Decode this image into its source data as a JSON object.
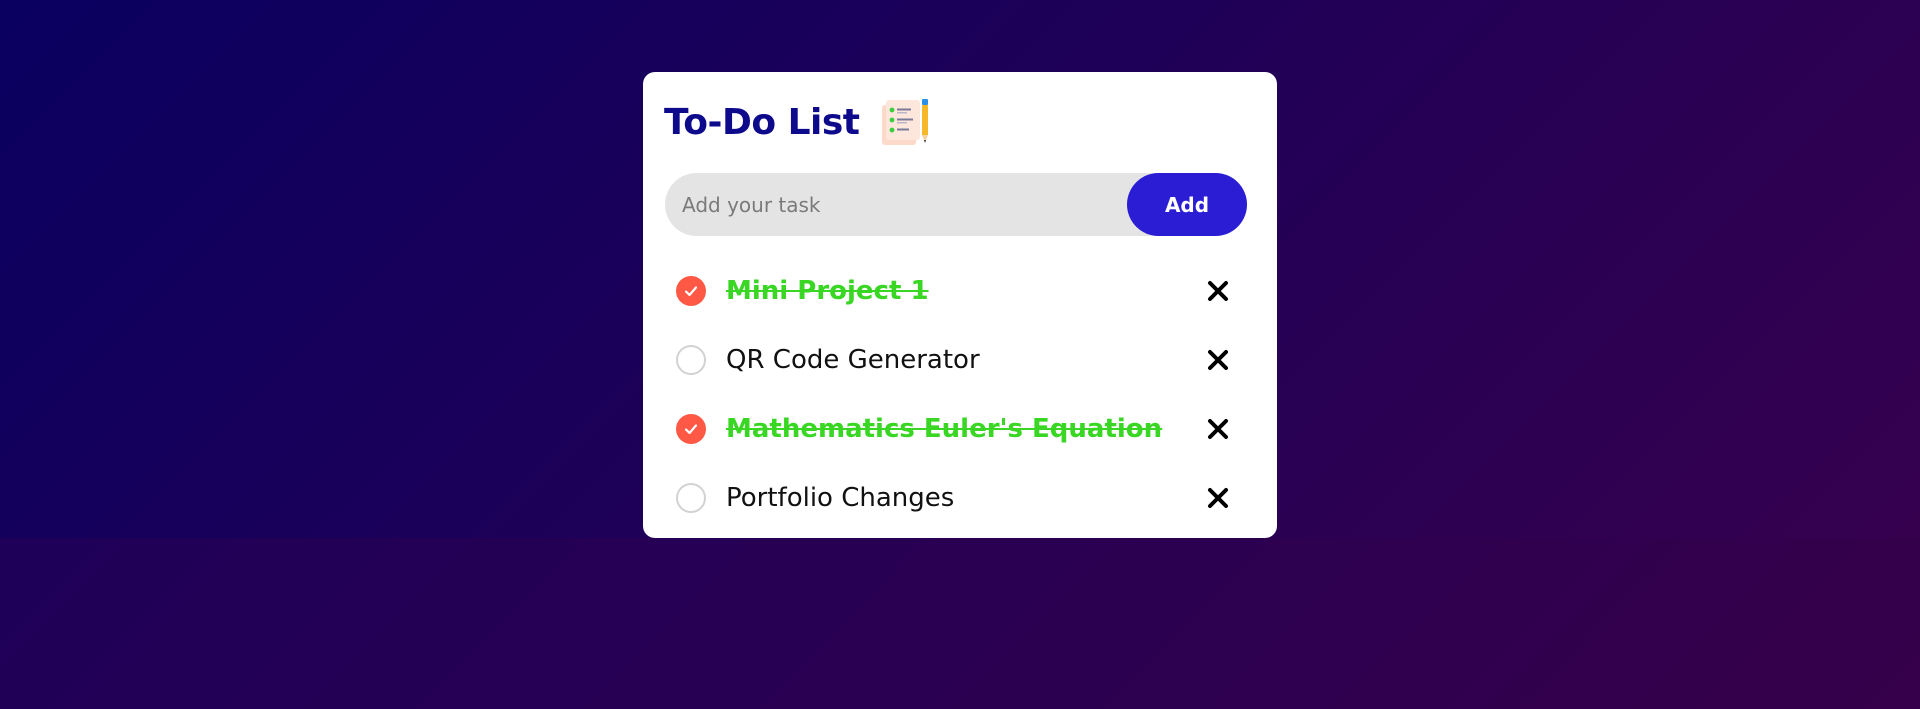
{
  "app": {
    "title": "To-Do List",
    "title_icon": "notepad-checklist-pencil-icon"
  },
  "input": {
    "placeholder": "Add your task",
    "value": "",
    "add_label": "Add"
  },
  "colors": {
    "accent": "#2a1dd4",
    "title": "#0d0a8c",
    "checked": "#ff5945",
    "done_text": "#39d623"
  },
  "tasks": [
    {
      "label": "Mini Project 1",
      "done": true
    },
    {
      "label": "QR Code Generator",
      "done": false
    },
    {
      "label": "Mathematics Euler's Equation",
      "done": true
    },
    {
      "label": "Portfolio Changes",
      "done": false
    }
  ]
}
